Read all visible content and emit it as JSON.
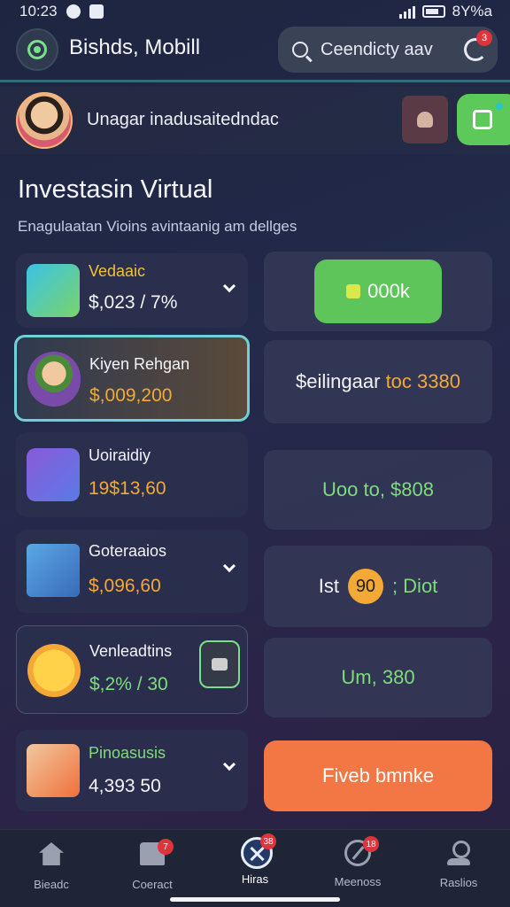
{
  "status_bar": {
    "time": "10:23",
    "battery": "8Y%a"
  },
  "header": {
    "title": "Bishds, Mobill",
    "search_placeholder": "Ceendicty aav",
    "notification_count": "3"
  },
  "profile": {
    "text": "Unagar inadusaitedndac"
  },
  "section": {
    "title": "Investasin Virtual",
    "subtitle": "Enagulaatan Vioins avintaanig am dellges"
  },
  "cards": [
    {
      "title": "Vedaaic",
      "value": "$,023 / 7%",
      "value_color": "#f3f4f8",
      "title_color": "#f2c23c"
    },
    {
      "title": "Kiyen Rehgan",
      "value": "$,009,200",
      "value_color": "#f4a836",
      "title_color": "#f3f4f8"
    },
    {
      "title": "Uoiraidiy",
      "value": "19$13,60",
      "value_color": "#f4a836",
      "title_color": "#f3f4f8"
    },
    {
      "title": "Goteraaios",
      "value": "$,096,60",
      "value_color": "#f4a836",
      "title_color": "#f3f4f8"
    },
    {
      "title": "Venleadtins",
      "value": "$,2% / 30",
      "value_color": "#7edc7b",
      "title_color": "#f3f4f8"
    },
    {
      "title": "Pinoasusis",
      "value": "4,393 50",
      "value_color": "#f3f4f8",
      "title_color": "#7edc7b"
    }
  ],
  "panels": {
    "p1_button": "000k",
    "p2_prefix": "$eilingaar",
    "p2_suffix": "toc 3380",
    "p3": "Uoo to, $808",
    "p4_prefix": "Ist",
    "p4_badge": "90",
    "p4_suffix": "; Diot",
    "p5": "Um, 380",
    "action_button": "Fiveb bmnke"
  },
  "nav": [
    {
      "label": "Bieadc",
      "badge": ""
    },
    {
      "label": "Coeract",
      "badge": "7"
    },
    {
      "label": "Hiras",
      "badge": "38"
    },
    {
      "label": "Meenoss",
      "badge": "18"
    },
    {
      "label": "Raslios",
      "badge": ""
    }
  ],
  "colors": {
    "green": "#5dc559",
    "orange": "#f37744",
    "cyan": "#6fd0d8",
    "red": "#e0333b"
  }
}
